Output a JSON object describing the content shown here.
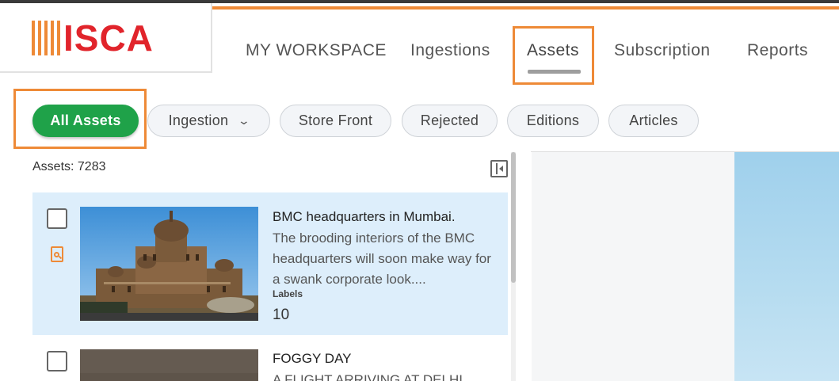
{
  "logo": {
    "text": "ISCA"
  },
  "nav": {
    "items": [
      {
        "label": "MY WORKSPACE"
      },
      {
        "label": "Ingestions"
      },
      {
        "label": "Assets"
      },
      {
        "label": "Subscription"
      },
      {
        "label": "Reports"
      }
    ],
    "active": "Assets"
  },
  "filters": {
    "all_assets": "All Assets",
    "ingestion": "Ingestion",
    "store_front": "Store Front",
    "rejected": "Rejected",
    "editions": "Editions",
    "articles": "Articles"
  },
  "assets": {
    "count_label": "Assets: 7283",
    "items": [
      {
        "title": "BMC headquarters in Mumbai.",
        "description": "The brooding interiors of the BMC headquarters will soon make way for a swank corporate look....",
        "labels_heading": "Labels",
        "labels_count": "10",
        "selected": true
      },
      {
        "title": "FOGGY DAY",
        "description": "A FLIGHT ARRIVING AT DELHI",
        "selected": false
      }
    ]
  },
  "colors": {
    "accent_orange": "#ee8a37",
    "brand_red": "#e1242b",
    "active_green": "#1fa249",
    "selected_row": "#ddeefb"
  }
}
